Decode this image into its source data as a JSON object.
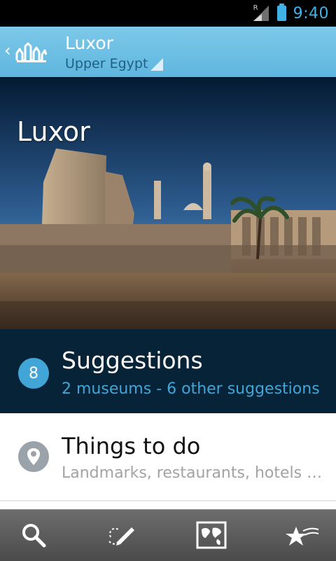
{
  "status_bar": {
    "signal_label": "R",
    "time": "9:40",
    "accent_color": "#41b2e6"
  },
  "action_bar": {
    "title": "Luxor",
    "subtitle": "Upper Egypt",
    "background_color": "#5fb6df"
  },
  "hero": {
    "title": "Luxor",
    "image_description_icon": "temple-photo"
  },
  "suggestions": {
    "count": "8",
    "title": "Suggestions",
    "subtitle": "2 museums - 6 other suggestions",
    "background_color": "#072338"
  },
  "things_to_do": {
    "title": "Things to do",
    "subtitle": "Landmarks, restaurants, hotels …",
    "icon": "map-pin-icon"
  },
  "tab_bar": {
    "tabs": [
      {
        "icon": "search-icon"
      },
      {
        "icon": "edit-route-icon"
      },
      {
        "icon": "world-map-icon"
      },
      {
        "icon": "favorites-stars-icon"
      }
    ]
  }
}
